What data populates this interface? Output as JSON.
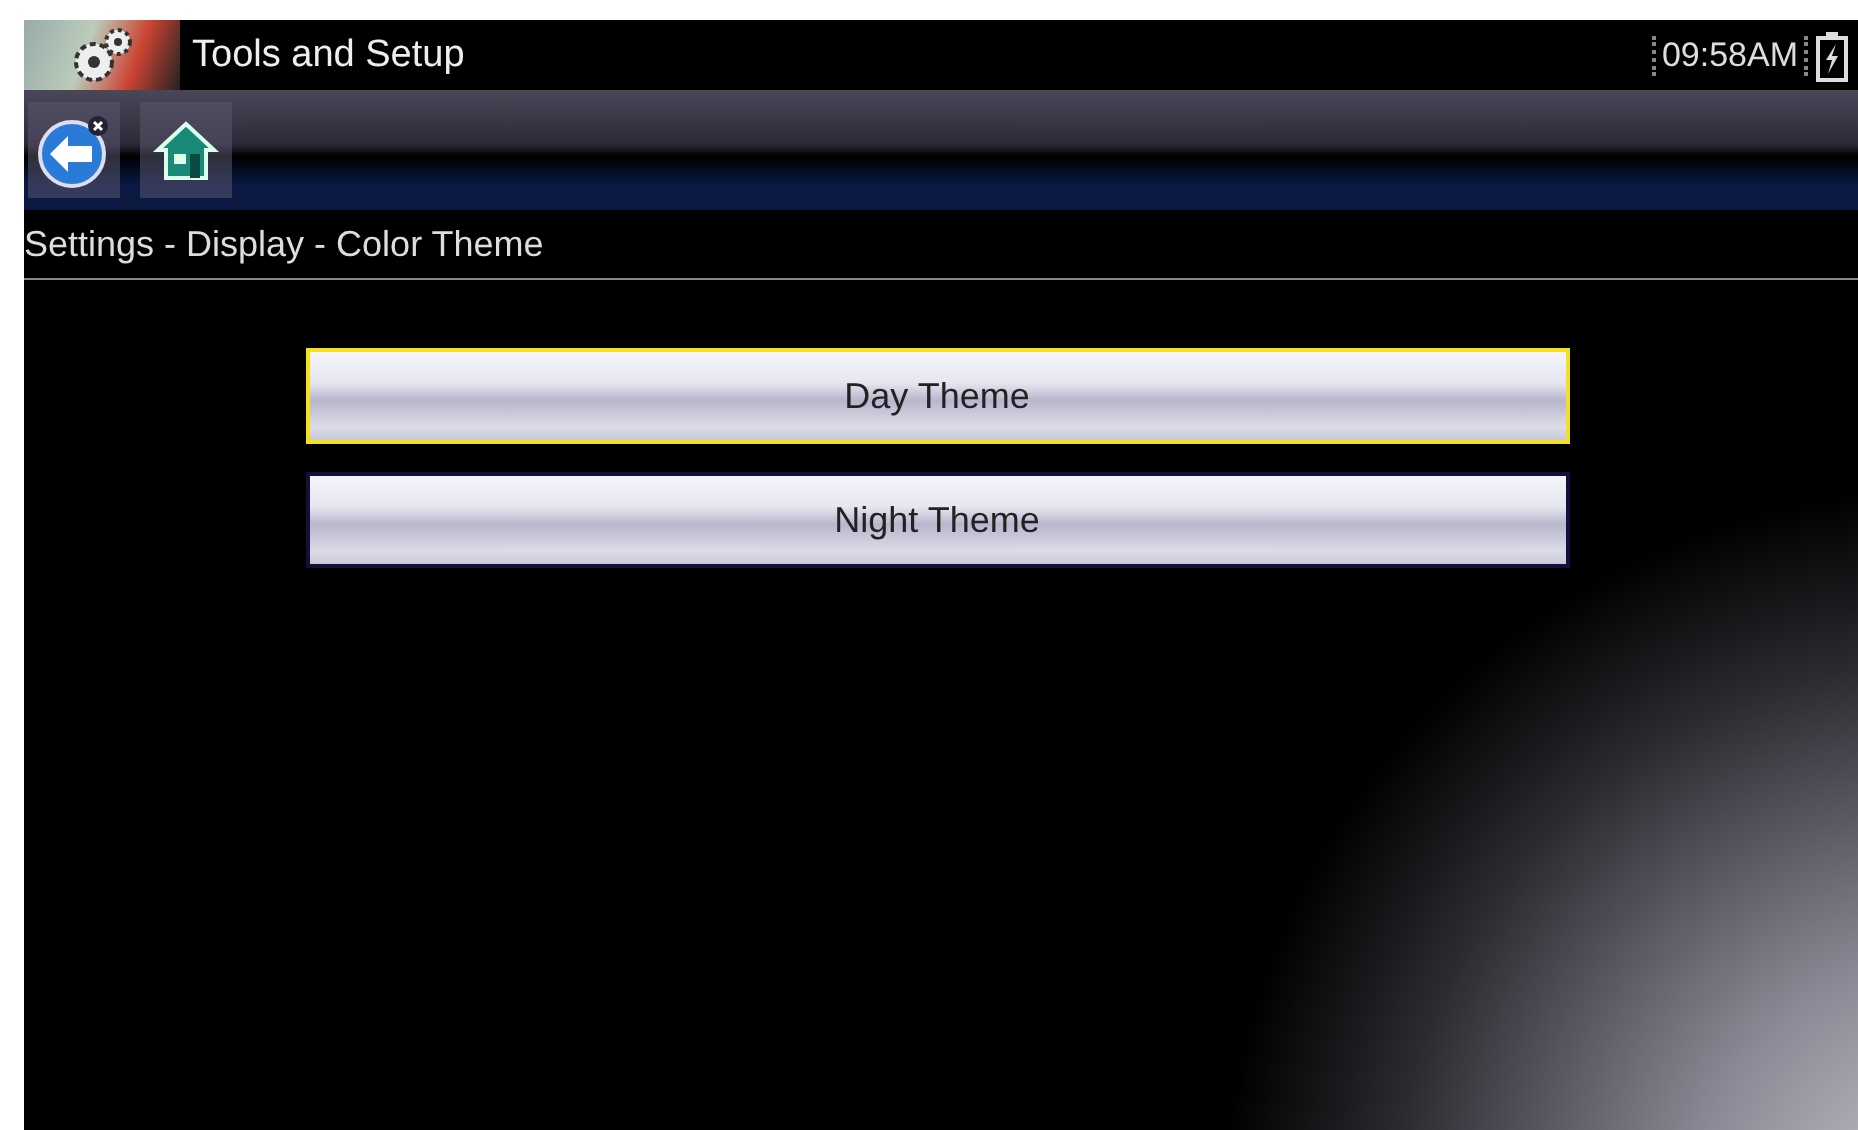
{
  "window": {
    "title": "Tools and Setup",
    "time": "09:58AM"
  },
  "breadcrumb": "Settings - Display - Color Theme",
  "options": [
    {
      "label": "Day Theme",
      "selected": true
    },
    {
      "label": "Night Theme",
      "selected": false
    }
  ]
}
